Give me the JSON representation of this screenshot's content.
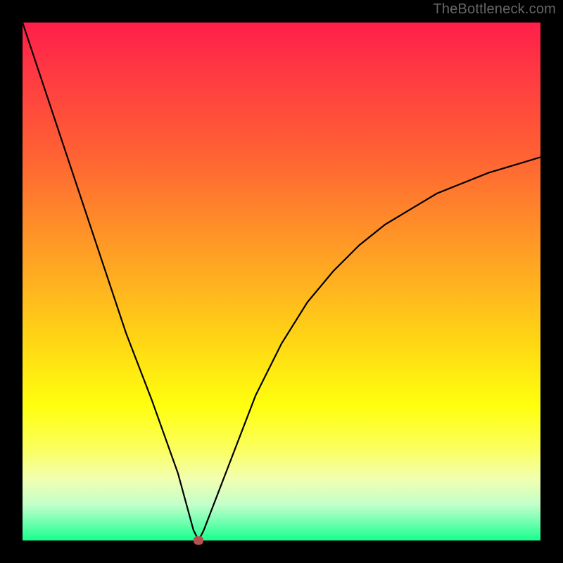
{
  "watermark": "TheBottleneck.com",
  "chart_data": {
    "type": "line",
    "title": "",
    "xlabel": "",
    "ylabel": "",
    "xlim": [
      0,
      100
    ],
    "ylim": [
      0,
      100
    ],
    "x": [
      0,
      5,
      10,
      15,
      20,
      25,
      30,
      33,
      34,
      35,
      40,
      45,
      50,
      55,
      60,
      65,
      70,
      75,
      80,
      85,
      90,
      95,
      100
    ],
    "values": [
      100,
      85,
      70,
      55,
      40,
      27,
      13,
      2,
      0,
      2,
      15,
      28,
      38,
      46,
      52,
      57,
      61,
      64,
      67,
      69,
      71,
      72.5,
      74
    ],
    "marker": {
      "x": 34,
      "y": 0
    }
  },
  "colors": {
    "curve": "#000000",
    "marker": "#b55050",
    "frame": "#000000"
  }
}
